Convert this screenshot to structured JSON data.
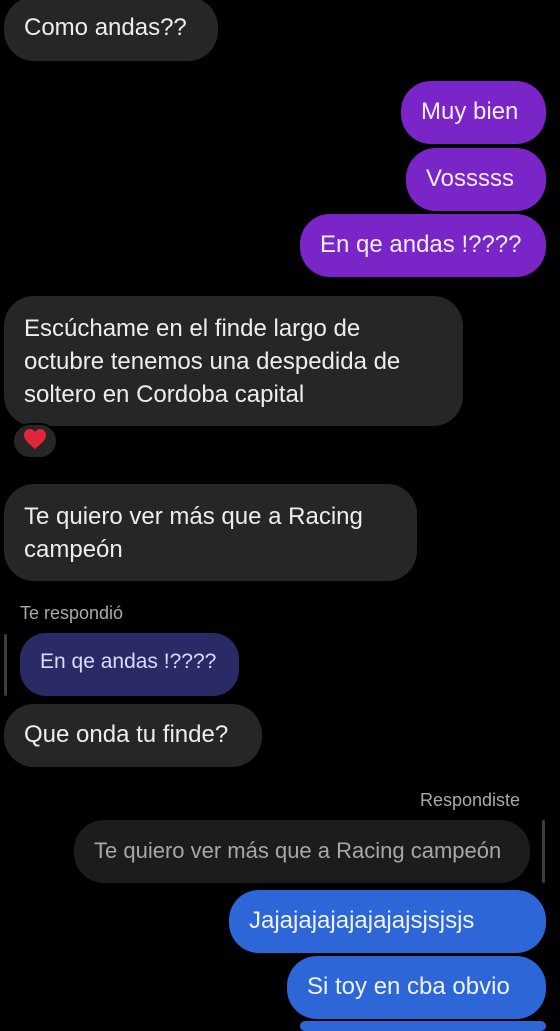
{
  "conversation": {
    "messages": [
      {
        "id": "m1",
        "sender": "them",
        "text": "Como andas??"
      },
      {
        "id": "m2",
        "sender": "me",
        "text": "Muy bien"
      },
      {
        "id": "m3",
        "sender": "me",
        "text": "Vosssss"
      },
      {
        "id": "m4",
        "sender": "me",
        "text": "En qe andas !????"
      },
      {
        "id": "m5",
        "sender": "them",
        "lines": [
          "Escúchame en el finde largo de",
          "octubre tenemos una despedida de",
          "soltero en Cordoba capital"
        ],
        "reaction": "❤️"
      },
      {
        "id": "m6",
        "sender": "them",
        "lines": [
          "Te quiero ver más que a Racing",
          "campeón"
        ]
      },
      {
        "id": "m7",
        "sender": "them",
        "reply_label": "Te respondió",
        "quoted": "En qe andas !????",
        "text": "Que onda tu finde?"
      },
      {
        "id": "m8",
        "sender": "me",
        "reply_label": "Respondiste",
        "quoted": "Te quiero ver más que a Racing campeón",
        "text": "Jajajajajajajajajsjsjsjs"
      },
      {
        "id": "m9",
        "sender": "me",
        "text": "Si toy en cba obvio"
      }
    ]
  },
  "colors": {
    "incoming_bubble": "#262626",
    "outgoing_purple": "#7a25c8",
    "outgoing_blue": "#2d66d6",
    "quoted_incoming": "#2a2a66",
    "background": "#000000"
  }
}
